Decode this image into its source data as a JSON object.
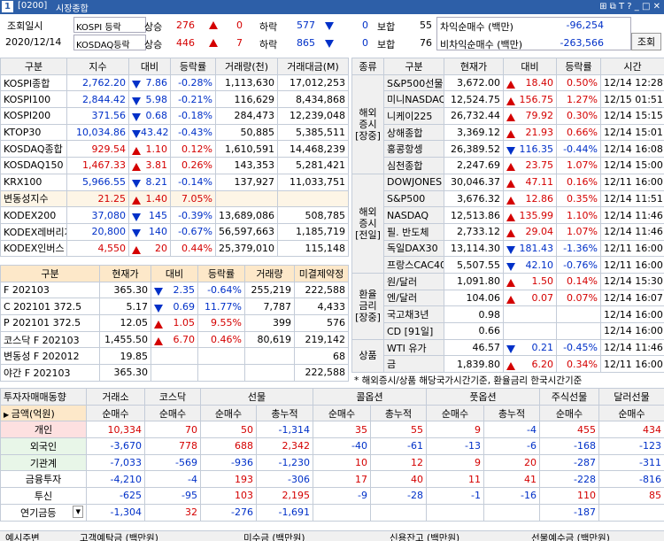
{
  "title": {
    "num": "1",
    "code": "[0200]",
    "name": "시장종합"
  },
  "top": {
    "date_label": "조회일시",
    "date": "2020/12/14",
    "kospi_label": "KOSPI 등락",
    "kosdaq_label": "KOSDAQ등락",
    "up": "상승",
    "down": "하락",
    "flat": "보합",
    "k_up": "276",
    "k_uplim": "0",
    "k_dn": "577",
    "k_dnlim": "0",
    "k_flat": "55",
    "q_up": "446",
    "q_uplim": "7",
    "q_dn": "865",
    "q_dnlim": "0",
    "q_flat": "76",
    "arb_label": "차익순매수 (백만)",
    "arb": "-96,254",
    "narb_label": "비차익순매수 (백만)",
    "narb": "-263,566",
    "query_btn": "조회"
  },
  "idx": {
    "headers": [
      "구분",
      "지수",
      "대비",
      "등락률",
      "거래량(천)",
      "거래대금(M)"
    ],
    "rows": [
      {
        "name": "KOSPI종합",
        "v": "2,762.20",
        "d": "7.86",
        "dir": "dn",
        "r": "-0.28%",
        "vol": "1,113,630",
        "amt": "17,012,253"
      },
      {
        "name": "KOSPI100",
        "v": "2,844.42",
        "d": "5.98",
        "dir": "dn",
        "r": "-0.21%",
        "vol": "116,629",
        "amt": "8,434,868"
      },
      {
        "name": "KOSPI200",
        "v": "371.56",
        "d": "0.68",
        "dir": "dn",
        "r": "-0.18%",
        "vol": "284,473",
        "amt": "12,239,048"
      },
      {
        "name": "KTOP30",
        "v": "10,034.86",
        "d": "43.42",
        "dir": "dn",
        "r": "-0.43%",
        "vol": "50,885",
        "amt": "5,385,511"
      },
      {
        "name": "KOSDAQ종합",
        "v": "929.54",
        "d": "1.10",
        "dir": "up",
        "r": "0.12%",
        "vol": "1,610,591",
        "amt": "14,468,239"
      },
      {
        "name": "KOSDAQ150",
        "v": "1,467.33",
        "d": "3.81",
        "dir": "up",
        "r": "0.26%",
        "vol": "143,353",
        "amt": "5,281,421"
      },
      {
        "name": "KRX100",
        "v": "5,966.55",
        "d": "8.21",
        "dir": "dn",
        "r": "-0.14%",
        "vol": "137,927",
        "amt": "11,033,751"
      },
      {
        "name": "변동성지수",
        "v": "21.25",
        "d": "1.40",
        "dir": "up",
        "r": "7.05%",
        "vol": "",
        "amt": ""
      },
      {
        "name": "KODEX200",
        "v": "37,080",
        "d": "145",
        "dir": "dn",
        "r": "-0.39%",
        "vol": "13,689,086",
        "amt": "508,785"
      },
      {
        "name": "KODEX레버리지",
        "v": "20,800",
        "d": "140",
        "dir": "dn",
        "r": "-0.67%",
        "vol": "56,597,663",
        "amt": "1,185,719"
      },
      {
        "name": "KODEX인버스",
        "v": "4,550",
        "d": "20",
        "dir": "up",
        "r": "0.44%",
        "vol": "25,379,010",
        "amt": "115,148"
      }
    ]
  },
  "fut": {
    "headers": [
      "구분",
      "현재가",
      "대비",
      "등락률",
      "거래량",
      "미결제약정"
    ],
    "rows": [
      {
        "name": "F 202103",
        "v": "365.30",
        "d": "2.35",
        "dir": "dn",
        "r": "-0.64%",
        "vol": "255,219",
        "oi": "222,588"
      },
      {
        "name": "C 202101 372.5",
        "v": "5.17",
        "d": "0.69",
        "dir": "dn",
        "r": "11.77%",
        "vol": "7,787",
        "oi": "4,433"
      },
      {
        "name": "P 202101 372.5",
        "v": "12.05",
        "d": "1.05",
        "dir": "up",
        "r": "9.55%",
        "vol": "399",
        "oi": "576"
      },
      {
        "name": "코스닥 F 202103",
        "v": "1,455.50",
        "d": "6.70",
        "dir": "up",
        "r": "0.46%",
        "vol": "80,619",
        "oi": "219,142"
      },
      {
        "name": "변동성 F 202012",
        "v": "19.85",
        "d": "",
        "dir": "",
        "r": "",
        "vol": "",
        "oi": "68"
      },
      {
        "name": "야간 F 202103",
        "v": "365.30",
        "d": "",
        "dir": "",
        "r": "",
        "vol": "",
        "oi": "222,588"
      }
    ]
  },
  "ov": {
    "headers": [
      "종류",
      "구분",
      "현재가",
      "대비",
      "등락률",
      "시간"
    ],
    "groups": [
      {
        "label": [
          "해외",
          "증시",
          "[장중]"
        ],
        "rows": [
          {
            "n": "S&P500선물",
            "v": "3,672.00",
            "d": "18.40",
            "dir": "up",
            "r": "0.50%",
            "t": "12/14 12:28"
          },
          {
            "n": "미니NASDAQ",
            "v": "12,524.75",
            "d": "156.75",
            "dir": "up",
            "r": "1.27%",
            "t": "12/15 01:51"
          },
          {
            "n": "니케이225",
            "v": "26,732.44",
            "d": "79.92",
            "dir": "up",
            "r": "0.30%",
            "t": "12/14 15:15"
          },
          {
            "n": "상해종합",
            "v": "3,369.12",
            "d": "21.93",
            "dir": "up",
            "r": "0.66%",
            "t": "12/14 15:01"
          },
          {
            "n": "홍콩항셍",
            "v": "26,389.52",
            "d": "116.35",
            "dir": "dn",
            "r": "-0.44%",
            "t": "12/14 16:08"
          },
          {
            "n": "심천종합",
            "v": "2,247.69",
            "d": "23.75",
            "dir": "up",
            "r": "1.07%",
            "t": "12/14 15:00"
          }
        ]
      },
      {
        "label": [
          "해외",
          "증시",
          "[전일]"
        ],
        "rows": [
          {
            "n": "DOWJONES",
            "v": "30,046.37",
            "d": "47.11",
            "dir": "up",
            "r": "0.16%",
            "t": "12/11 16:00"
          },
          {
            "n": "S&P500",
            "v": "3,676.32",
            "d": "12.86",
            "dir": "up",
            "r": "0.35%",
            "t": "12/14 11:51"
          },
          {
            "n": "NASDAQ",
            "v": "12,513.86",
            "d": "135.99",
            "dir": "up",
            "r": "1.10%",
            "t": "12/14 11:46"
          },
          {
            "n": "필. 반도체",
            "v": "2,733.12",
            "d": "29.04",
            "dir": "up",
            "r": "1.07%",
            "t": "12/14 11:46"
          },
          {
            "n": "독일DAX30",
            "v": "13,114.30",
            "d": "181.43",
            "dir": "dn",
            "r": "-1.36%",
            "t": "12/11 16:00"
          },
          {
            "n": "프랑스CAC40",
            "v": "5,507.55",
            "d": "42.10",
            "dir": "dn",
            "r": "-0.76%",
            "t": "12/11 16:00"
          }
        ]
      },
      {
        "label": [
          "환율",
          "금리",
          "[장중]"
        ],
        "rows": [
          {
            "n": "원/달러",
            "v": "1,091.80",
            "d": "1.50",
            "dir": "up",
            "r": "0.14%",
            "t": "12/14 15:30"
          },
          {
            "n": "엔/달러",
            "v": "104.06",
            "d": "0.07",
            "dir": "up",
            "r": "0.07%",
            "t": "12/14 16:07"
          },
          {
            "n": "국고채3년",
            "v": "0.98",
            "d": "",
            "dir": "",
            "r": "",
            "t": "12/14 16:00"
          },
          {
            "n": "CD [91일]",
            "v": "0.66",
            "d": "",
            "dir": "",
            "r": "",
            "t": "12/14 16:00"
          }
        ]
      },
      {
        "label": [
          "상품"
        ],
        "rows": [
          {
            "n": "WTI 유가",
            "v": "46.57",
            "d": "0.21",
            "dir": "dn",
            "r": "-0.45%",
            "t": "12/14 11:46"
          },
          {
            "n": "금",
            "v": "1,839.80",
            "d": "6.20",
            "dir": "up",
            "r": "0.34%",
            "t": "12/11 16:00"
          }
        ]
      }
    ],
    "note": "* 해외증시/상품 해당국가시간기준, 환율금리 한국시간기준"
  },
  "inv": {
    "title": "투자자매매동향",
    "unit": "금액(억원)",
    "cols": [
      "거래소",
      "코스닥",
      "선물",
      "콜옵션",
      "풋옵션",
      "주식선물",
      "달러선물"
    ],
    "sub": [
      "순매수",
      "순매수",
      "순매수",
      "총누적",
      "순매수",
      "총누적",
      "순매수",
      "총누적",
      "순매수",
      "순매수"
    ],
    "rows": [
      {
        "name": "개인",
        "v": [
          "10,334",
          "70",
          "50",
          "-1,314",
          "35",
          "55",
          "9",
          "-4",
          "455",
          "434"
        ]
      },
      {
        "name": "외국인",
        "v": [
          "-3,670",
          "778",
          "688",
          "2,342",
          "-40",
          "-61",
          "-13",
          "-6",
          "-168",
          "-123"
        ]
      },
      {
        "name": "기관계",
        "v": [
          "-7,033",
          "-569",
          "-936",
          "-1,230",
          "10",
          "12",
          "9",
          "20",
          "-287",
          "-311"
        ]
      },
      {
        "name": "금융투자",
        "v": [
          "-4,210",
          "-4",
          "193",
          "-306",
          "17",
          "40",
          "11",
          "41",
          "-228",
          "-816"
        ]
      },
      {
        "name": "투신",
        "v": [
          "-625",
          "-95",
          "103",
          "2,195",
          "-9",
          "-28",
          "-1",
          "-16",
          "110",
          "85"
        ]
      },
      {
        "name": "연기금등",
        "v": [
          "-1,304",
          "32",
          "-276",
          "-1,691",
          "",
          "",
          "",
          "",
          "-187",
          ""
        ]
      }
    ]
  },
  "bottom": {
    "a": "예시주변",
    "b": "고객예탁금 (백만원)",
    "c": "미수금 (백만원)",
    "d": "신용잔고 (백만원)",
    "e": "선물예수금 (백만원)"
  }
}
